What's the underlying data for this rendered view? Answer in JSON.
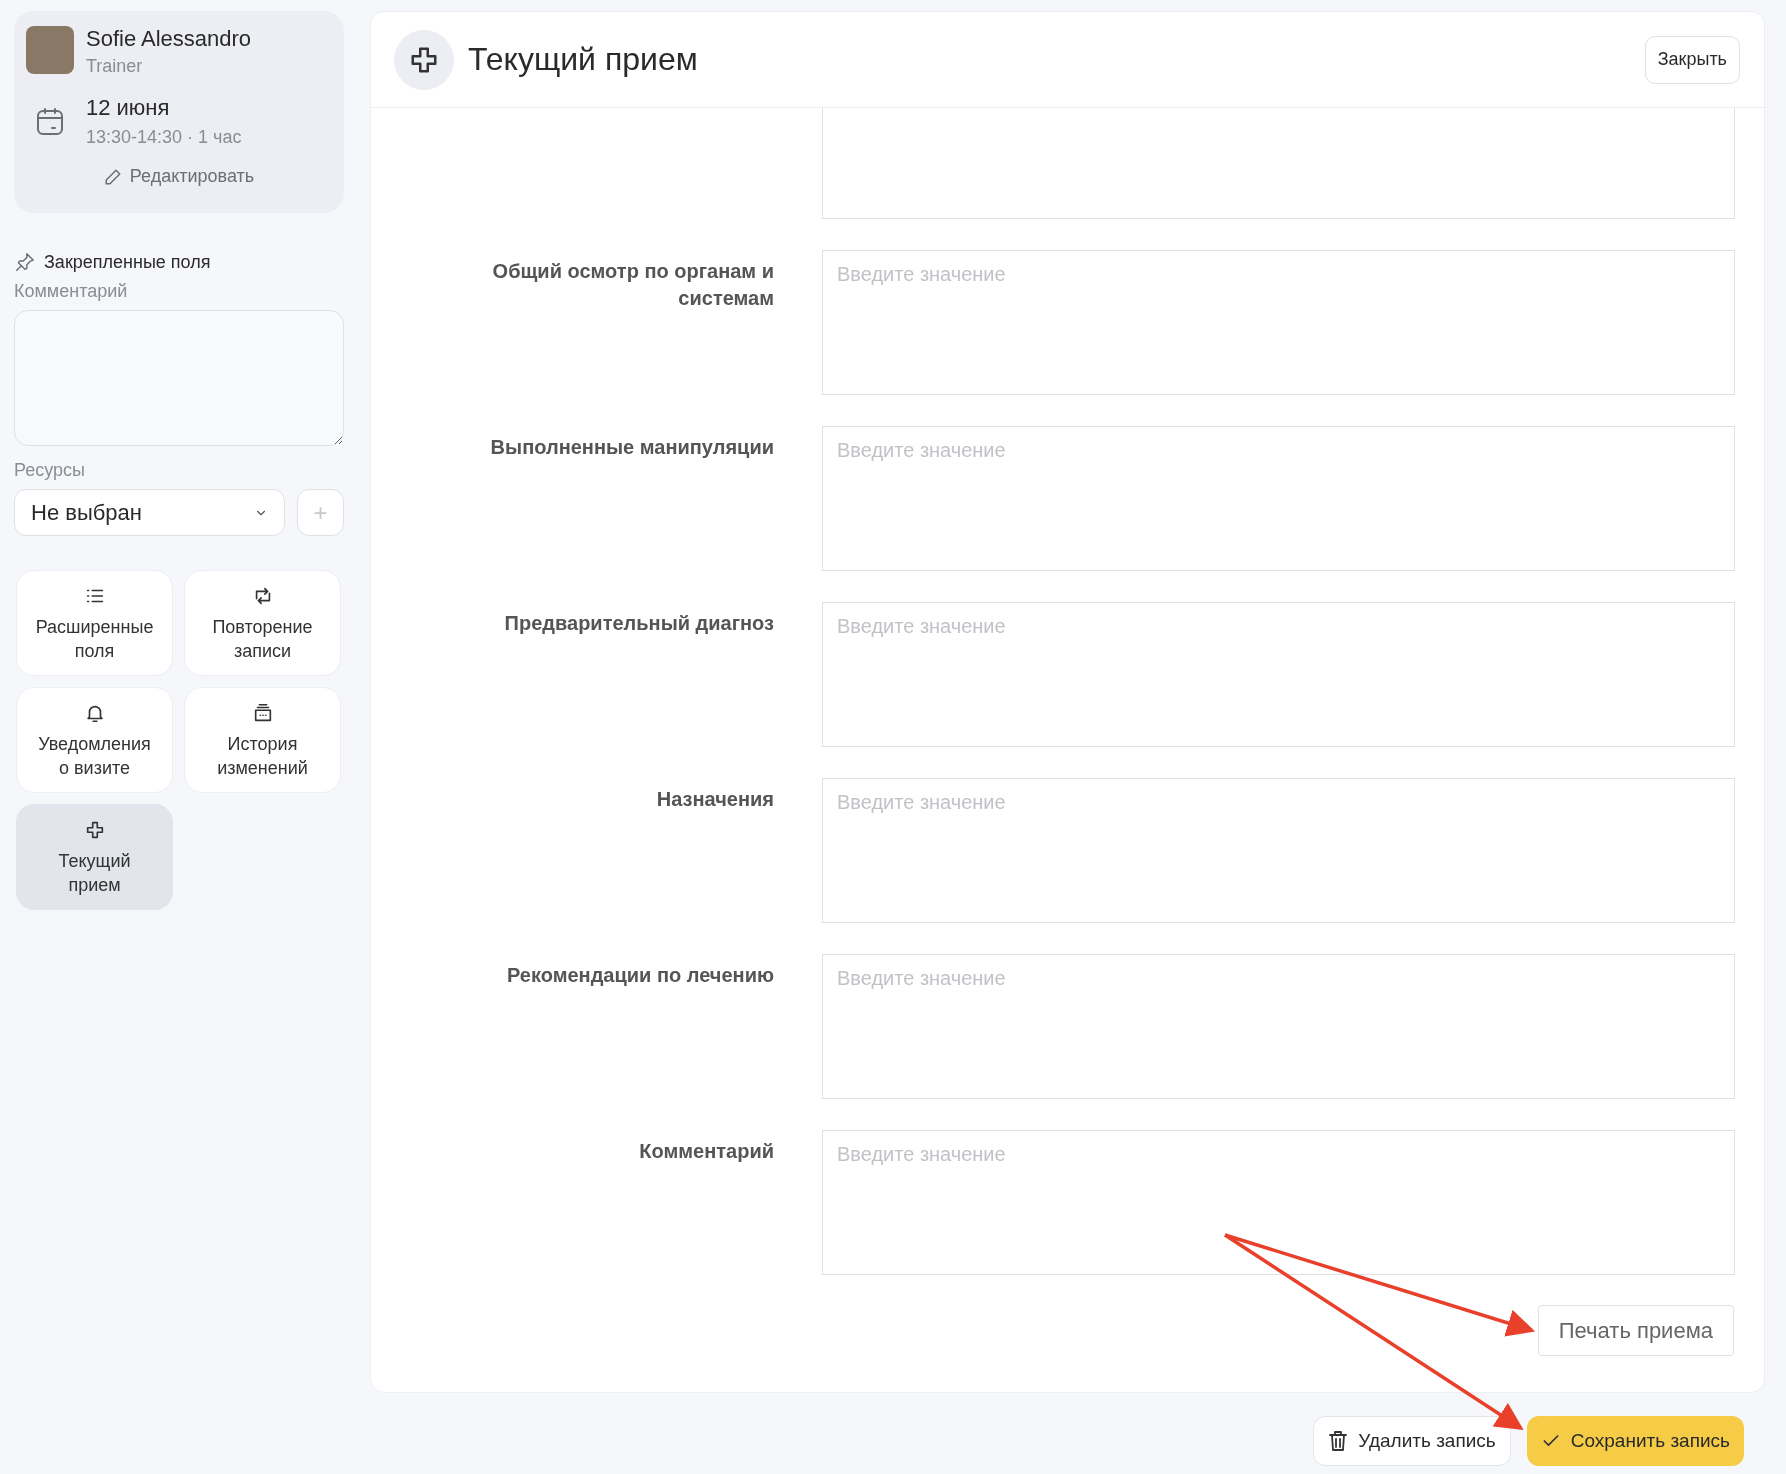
{
  "profile": {
    "name": "Sofie Alessandro",
    "role": "Trainer",
    "date": "12 июня",
    "time": "13:30-14:30 · 1 час",
    "edit_link": "Редактировать"
  },
  "sidebar": {
    "pinned_title": "Закрепленные поля",
    "comment_label": "Комментарий",
    "resources_label": "Ресурсы",
    "resources_value": "Не выбран",
    "add_button": "+",
    "tiles": [
      {
        "kind": "list",
        "label": "Расширенные поля",
        "selected": false
      },
      {
        "kind": "repeat",
        "label": "Повторение записи",
        "selected": false
      },
      {
        "kind": "bell",
        "label": "Уведомления о визите",
        "selected": false
      },
      {
        "kind": "history",
        "label": "История изменений",
        "selected": false
      },
      {
        "kind": "cross",
        "label": "Текущий прием",
        "selected": true
      }
    ]
  },
  "panel": {
    "title": "Текущий прием",
    "close_button": "Закрыть",
    "print_button": "Печать приема",
    "fields": [
      {
        "kind": "cut_off"
      },
      {
        "kind": "full",
        "label": "Общий осмотр по органам и системам",
        "placeholder": "Введите значение"
      },
      {
        "kind": "full",
        "label": "Выполненные манипуляции",
        "placeholder": "Введите значение"
      },
      {
        "kind": "full",
        "label": "Предварительный диагноз",
        "placeholder": "Введите значение"
      },
      {
        "kind": "full",
        "label": "Назначения",
        "placeholder": "Введите значение"
      },
      {
        "kind": "full",
        "label": "Рекомендации по лечению",
        "placeholder": "Введите значение"
      },
      {
        "kind": "full",
        "label": "Комментарий",
        "placeholder": "Введите значение"
      }
    ]
  },
  "footer": {
    "delete_button": "Удалить запись",
    "save_button": "Сохранить запись"
  },
  "annotation_arrows": {
    "to_print_button": true,
    "to_save_button": true
  }
}
